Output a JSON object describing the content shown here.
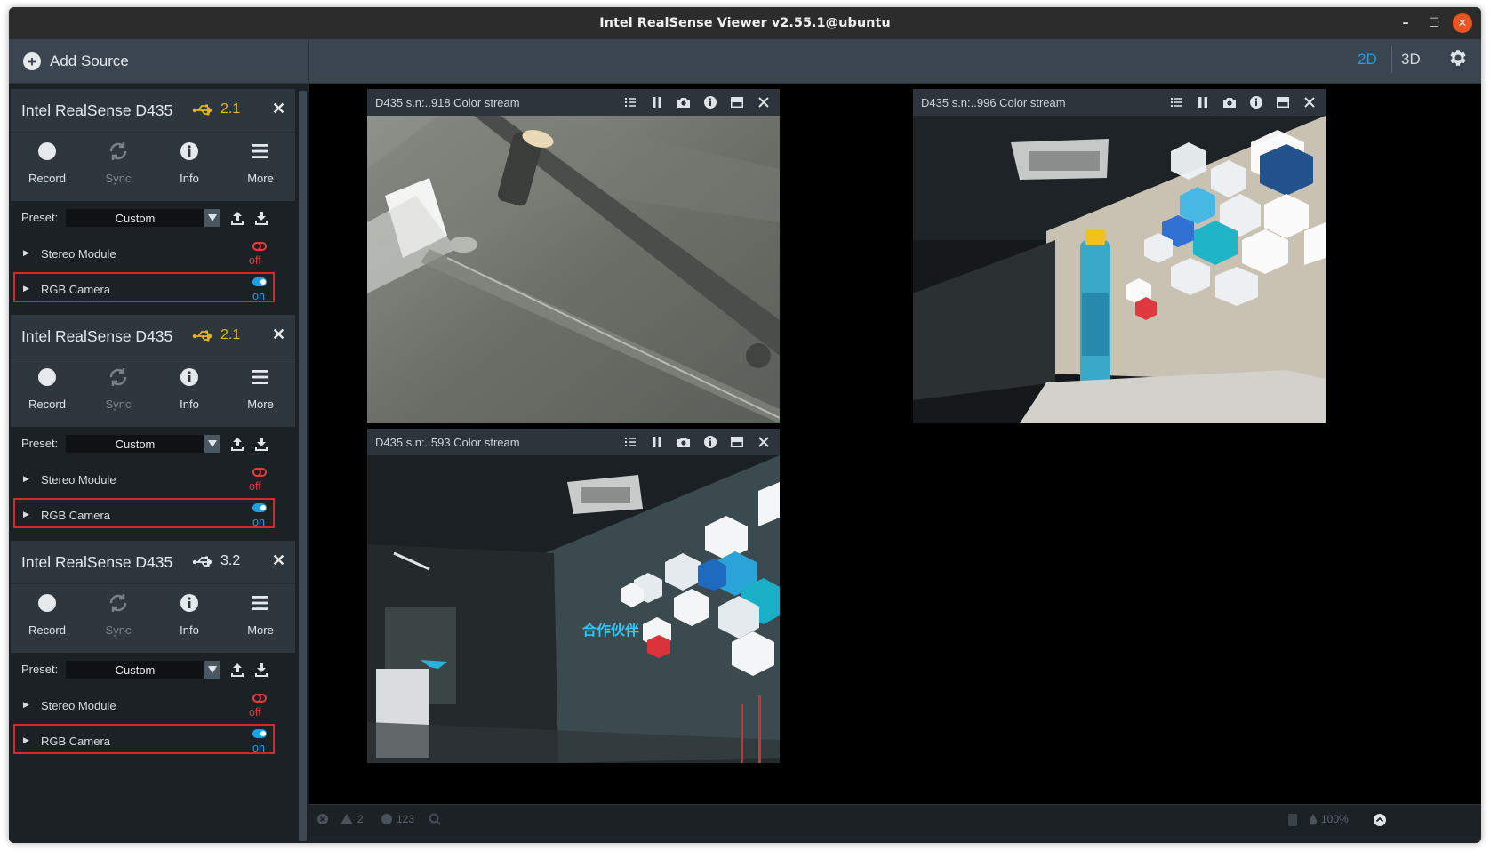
{
  "window": {
    "title": "Intel RealSense Viewer v2.55.1@ubuntu"
  },
  "toolbar": {
    "add_source_label": "Add Source",
    "view_2d": "2D",
    "view_3d": "3D"
  },
  "devices": [
    {
      "name": "Intel RealSense D435",
      "usb": "2.1",
      "usb_color": "#e6b422",
      "controls": {
        "record": "Record",
        "sync": "Sync",
        "info": "Info",
        "more": "More"
      },
      "preset_label": "Preset:",
      "preset_value": "Custom",
      "modules": [
        {
          "name": "Stereo Module",
          "state": "off"
        },
        {
          "name": "RGB Camera",
          "state": "on"
        }
      ]
    },
    {
      "name": "Intel RealSense D435",
      "usb": "2.1",
      "usb_color": "#e6b422",
      "controls": {
        "record": "Record",
        "sync": "Sync",
        "info": "Info",
        "more": "More"
      },
      "preset_label": "Preset:",
      "preset_value": "Custom",
      "modules": [
        {
          "name": "Stereo Module",
          "state": "off"
        },
        {
          "name": "RGB Camera",
          "state": "on"
        }
      ]
    },
    {
      "name": "Intel RealSense D435",
      "usb": "3.2",
      "usb_color": "#e6e9ec",
      "controls": {
        "record": "Record",
        "sync": "Sync",
        "info": "Info",
        "more": "More"
      },
      "preset_label": "Preset:",
      "preset_value": "Custom",
      "modules": [
        {
          "name": "Stereo Module",
          "state": "off"
        },
        {
          "name": "RGB Camera",
          "state": "on"
        }
      ]
    }
  ],
  "streams": [
    {
      "title": "D435 s.n:..918 Color stream"
    },
    {
      "title": "D435 s.n:..996 Color stream"
    },
    {
      "title": "D435 s.n:..593 Color stream"
    }
  ],
  "status": {
    "warnings": "2",
    "info_count": "123",
    "zoom": "100%"
  },
  "colors": {
    "accent": "#1ea0e6",
    "off": "#e03c3c",
    "highlight": "#d62828",
    "close": "#e95420"
  }
}
